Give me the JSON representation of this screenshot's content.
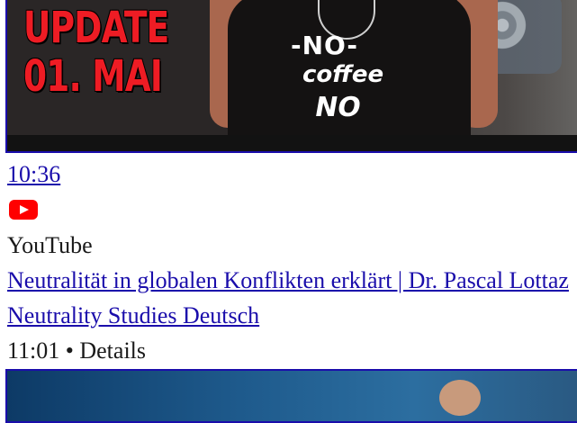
{
  "video1": {
    "thumbnail_text_line1": "UPDATE",
    "thumbnail_text_line2": "01. MAI",
    "shirt_text_1": "-NO-",
    "shirt_text_2": "coffee",
    "shirt_text_3": "NO",
    "duration": "10:36"
  },
  "video2": {
    "source_icon": "youtube-icon",
    "source": "YouTube",
    "title": "Neutralität in globalen Konflikten erklärt | Dr. Pascal Lottaz",
    "channel": "Neutrality Studies Deutsch",
    "meta": "11:01 • Details"
  },
  "colors": {
    "link": "#1a0dab",
    "youtube_red": "#ff0000",
    "thumbnail_red": "#ee1c24"
  }
}
